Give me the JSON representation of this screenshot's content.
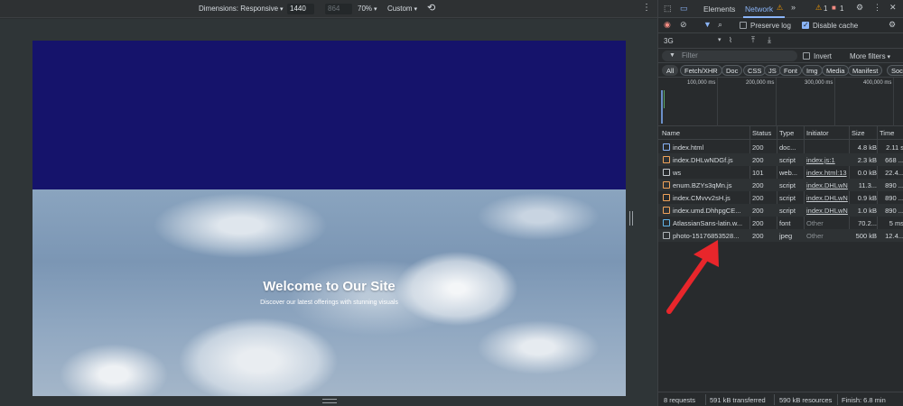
{
  "device_toolbar": {
    "dimensions_label": "Dimensions: Responsive",
    "width": "1440",
    "height": "864",
    "zoom": "70%",
    "throttle": "Custom"
  },
  "webpage": {
    "hero_title": "Welcome to Our Site",
    "hero_subtitle": "Discover our latest offerings with stunning visuals"
  },
  "devtools": {
    "tabs": [
      "Elements",
      "Network"
    ],
    "warnings": "1",
    "errors": "1",
    "preserve_log": "Preserve log",
    "disable_cache": "Disable cache",
    "throttle": "3G",
    "filter_placeholder": "Filter",
    "invert": "Invert",
    "more_filters": "More filters",
    "types": [
      "All",
      "Fetch/XHR",
      "Doc",
      "CSS",
      "JS",
      "Font",
      "Img",
      "Media",
      "Manifest",
      "Sock"
    ],
    "timeline_ticks": [
      "100,000 ms",
      "200,000 ms",
      "300,000 ms",
      "400,000 ms"
    ],
    "columns": {
      "name": "Name",
      "status": "Status",
      "type": "Type",
      "initiator": "Initiator",
      "size": "Size",
      "time": "Time"
    },
    "rows": [
      {
        "name": "index.html",
        "status": "200",
        "type": "doc...",
        "initiator": "",
        "size": "4.8 kB",
        "time": "2.11 s",
        "kind": "doc"
      },
      {
        "name": "index.DHLwNDGf.js",
        "status": "200",
        "type": "script",
        "initiator": "index.js:1",
        "size": "2.3 kB",
        "time": "668 ...",
        "kind": "js"
      },
      {
        "name": "ws",
        "status": "101",
        "type": "web...",
        "initiator": "index.html:13",
        "size": "0.0 kB",
        "time": "22.4...",
        "kind": "ws"
      },
      {
        "name": "enum.BZYs3qMn.js",
        "status": "200",
        "type": "script",
        "initiator": "index.DHLwN",
        "size": "11.3...",
        "time": "890 ...",
        "kind": "js"
      },
      {
        "name": "index.CMvvv2sH.js",
        "status": "200",
        "type": "script",
        "initiator": "index.DHLwN",
        "size": "0.9 kB",
        "time": "890 ...",
        "kind": "js"
      },
      {
        "name": "index.umd.DhhpgCE...",
        "status": "200",
        "type": "script",
        "initiator": "index.DHLwN",
        "size": "1.0 kB",
        "time": "890 ...",
        "kind": "js"
      },
      {
        "name": "AtlassianSans-latin.w...",
        "status": "200",
        "type": "font",
        "initiator": "Other",
        "size": "70.2...",
        "time": "5 ms",
        "kind": "font"
      },
      {
        "name": "photo-15176853528...",
        "status": "200",
        "type": "jpeg",
        "initiator": "Other",
        "size": "500 kB",
        "time": "12.4...",
        "kind": "img"
      }
    ],
    "status": {
      "requests": "8 requests",
      "transferred": "591 kB transferred",
      "resources": "590 kB resources",
      "finish": "Finish: 6.8 min"
    }
  },
  "colors": {
    "hero_top": "#15136b",
    "arrow": "#e8262b",
    "accent": "#8ab4f8"
  }
}
